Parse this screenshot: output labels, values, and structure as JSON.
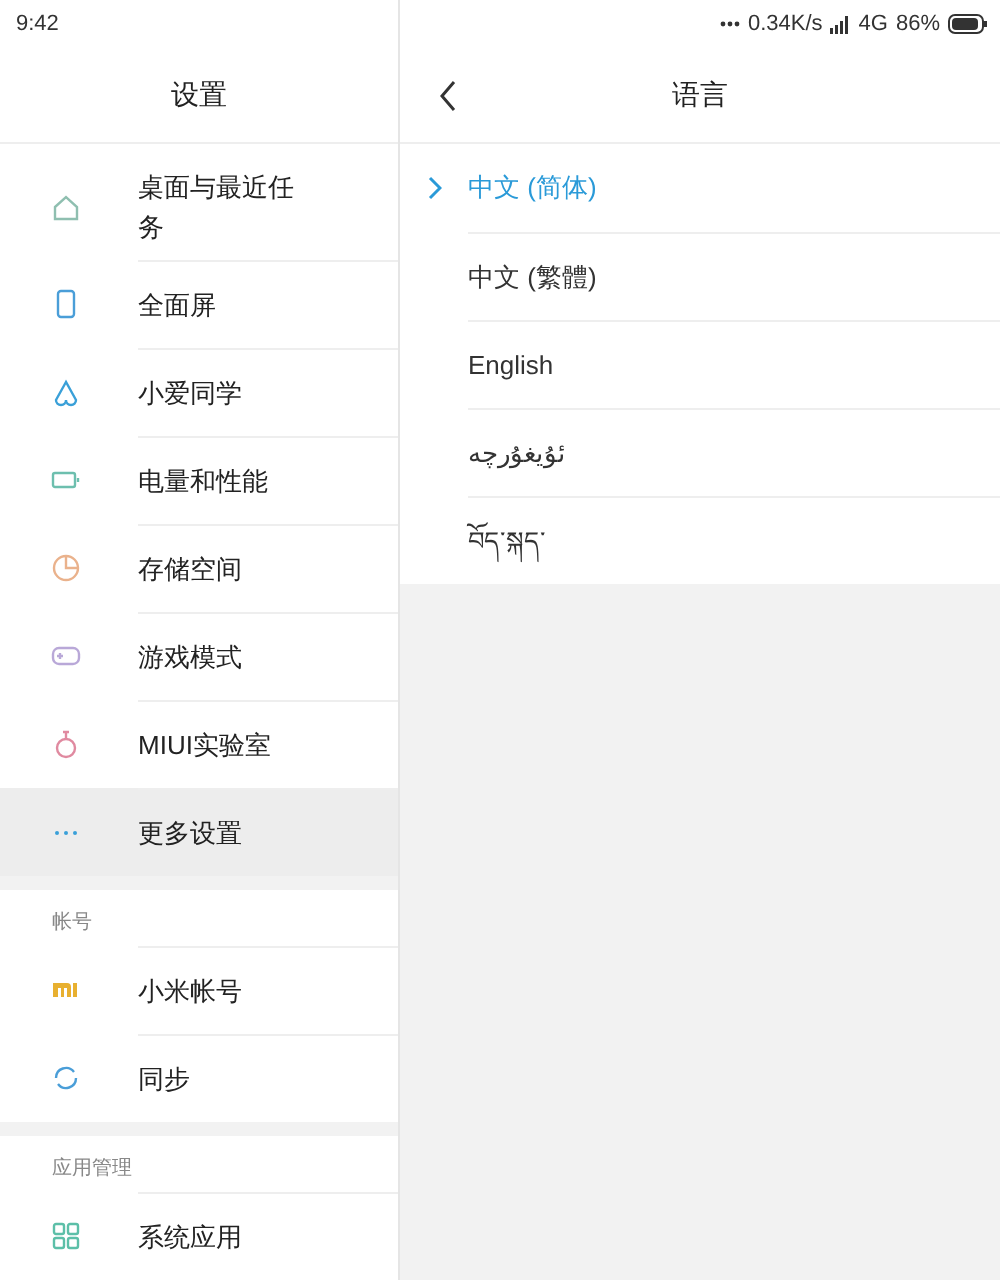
{
  "status_bar": {
    "time": "9:42",
    "speed": "0.34K/s",
    "network": "4G",
    "battery": "86%"
  },
  "left": {
    "title": "设置",
    "sections": [
      {
        "items": [
          {
            "label": "桌面与最近任务",
            "kind": "home",
            "selected": false
          },
          {
            "label": "全面屏",
            "kind": "phone",
            "selected": false
          },
          {
            "label": "小爱同学",
            "kind": "assistant",
            "selected": false
          },
          {
            "label": "电量和性能",
            "kind": "battery",
            "selected": false
          },
          {
            "label": "存储空间",
            "kind": "pie",
            "selected": false
          },
          {
            "label": "游戏模式",
            "kind": "gamepad",
            "selected": false
          },
          {
            "label": "MIUI实验室",
            "kind": "flask",
            "selected": false
          },
          {
            "label": "更多设置",
            "kind": "more",
            "selected": true
          }
        ]
      },
      {
        "header": "帐号",
        "items": [
          {
            "label": "小米帐号",
            "kind": "mi",
            "selected": false
          },
          {
            "label": "同步",
            "kind": "sync",
            "selected": false
          }
        ]
      },
      {
        "header": "应用管理",
        "items": [
          {
            "label": "系统应用",
            "kind": "grid",
            "selected": false
          }
        ]
      }
    ]
  },
  "right": {
    "title": "语言",
    "languages": [
      {
        "label": "中文 (简体)",
        "selected": true
      },
      {
        "label": "中文 (繁體)",
        "selected": false
      },
      {
        "label": "English",
        "selected": false
      },
      {
        "label": "ئۇيغۇرچە",
        "selected": false
      },
      {
        "label": "བོད་སྐད་",
        "selected": false
      }
    ]
  }
}
